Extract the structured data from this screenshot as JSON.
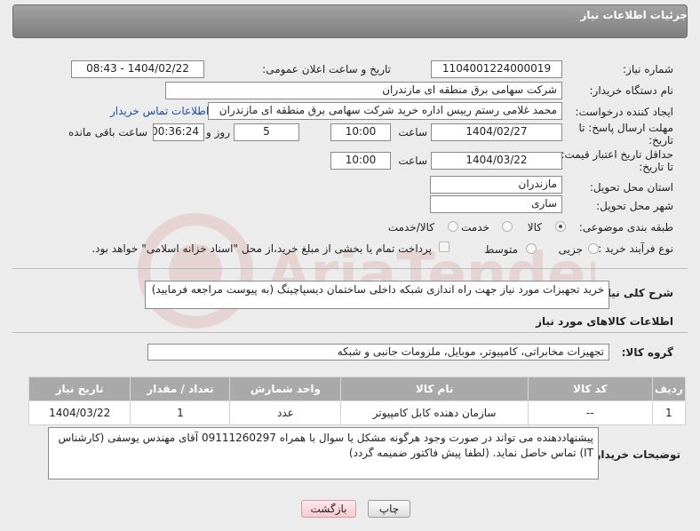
{
  "panel": {
    "title": "جزئیات اطلاعات نیاز"
  },
  "fields": {
    "need_number_label": "شماره نیاز:",
    "need_number": "1104001224000019",
    "announce_label": "تاریخ و ساعت اعلان عمومی:",
    "announce_value": "1404/02/22 - 08:43",
    "buyer_org_label": "نام دستگاه خریدار:",
    "buyer_org": "شرکت سهامی برق منطقه ای مازندران",
    "creator_label": "ایجاد کننده درخواست:",
    "creator": "محمد غلامی رستم رییس اداره خرید شرکت سهامی برق منطقه ای مازندران",
    "contact_link": "اطلاعات تماس خریدار",
    "deadline_label_1": "مهلت ارسال پاسخ: تا",
    "deadline_label_2": "تاریخ:",
    "deadline_date": "1404/02/27",
    "time_label": "ساعت",
    "deadline_time": "10:00",
    "days_value": "5",
    "days_label": "روز و",
    "remaining_time": "00:36:24",
    "remaining_label": "ساعت باقی مانده",
    "min_price_label_1": "حداقل تاریخ اعتبار قیمت:",
    "min_price_label_2": "تا تاریخ:",
    "min_price_date": "1404/03/22",
    "min_price_time": "10:00",
    "province_label": "استان محل تحویل:",
    "province": "مازندران",
    "city_label": "شهر محل تحویل:",
    "city": "ساری",
    "category_label": "طبقه بندی موضوعی:",
    "category_options": [
      "کالا",
      "خدمت",
      "کالا/خدمت"
    ],
    "process_label": "نوع فرآیند خرید :",
    "process_options": [
      "جزیی",
      "متوسط"
    ],
    "payment_note": "پرداخت تمام یا بخشی از مبلغ خرید،از محل \"اسناد خزانه اسلامی\" خواهد بود.",
    "description_label": "شرح کلی نیاز:",
    "description": "خرید تجهیزات مورد نیاز جهت راه اندازی شبکه داخلی ساختمان دیسپاچینگ (به پیوست مراجعه فرمایید)"
  },
  "goods": {
    "section_title": "اطلاعات کالاهای مورد نیاز",
    "group_label": "گروه کالا:",
    "group_value": "تجهیزات مخابراتی، کامپیوتر، موبایل، ملزومات جانبی و شبکه",
    "columns": [
      "ردیف",
      "کد کالا",
      "نام کالا",
      "واحد شمارش",
      "تعداد / مقدار",
      "تاریخ نیاز"
    ],
    "rows": [
      [
        "1",
        "--",
        "سازمان دهنده کابل کامپیوتر",
        "عدد",
        "1",
        "1404/03/22"
      ]
    ]
  },
  "notes": {
    "label": "توضیحات خریدار:",
    "text": "پیشنهاددهنده می تواند در صورت وجود هرگونه مشکل یا سوال با همراه 09111260297 آقای مهندس یوسفی (کارشناس IT) تماس حاصل نماید. (لطفا پیش فاکتور ضمیمه گردد)"
  },
  "buttons": {
    "print": "چاپ",
    "back": "بازگشت"
  },
  "watermark": {
    "text": "AriaTender.net",
    "color": "#c0392b"
  }
}
